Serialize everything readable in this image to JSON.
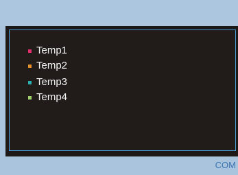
{
  "legend": {
    "items": [
      {
        "label": "Temp1",
        "color": "#e0306e"
      },
      {
        "label": "Temp2",
        "color": "#e09030"
      },
      {
        "label": "Temp3",
        "color": "#2ab0b0"
      },
      {
        "label": "Temp4",
        "color": "#9ed070"
      }
    ]
  },
  "status": {
    "label": "COM"
  },
  "colors": {
    "frame_background": "#a9c4dc",
    "display_background": "#211c19",
    "display_border": "#4a9fd9",
    "status_text": "#3b74b2"
  }
}
